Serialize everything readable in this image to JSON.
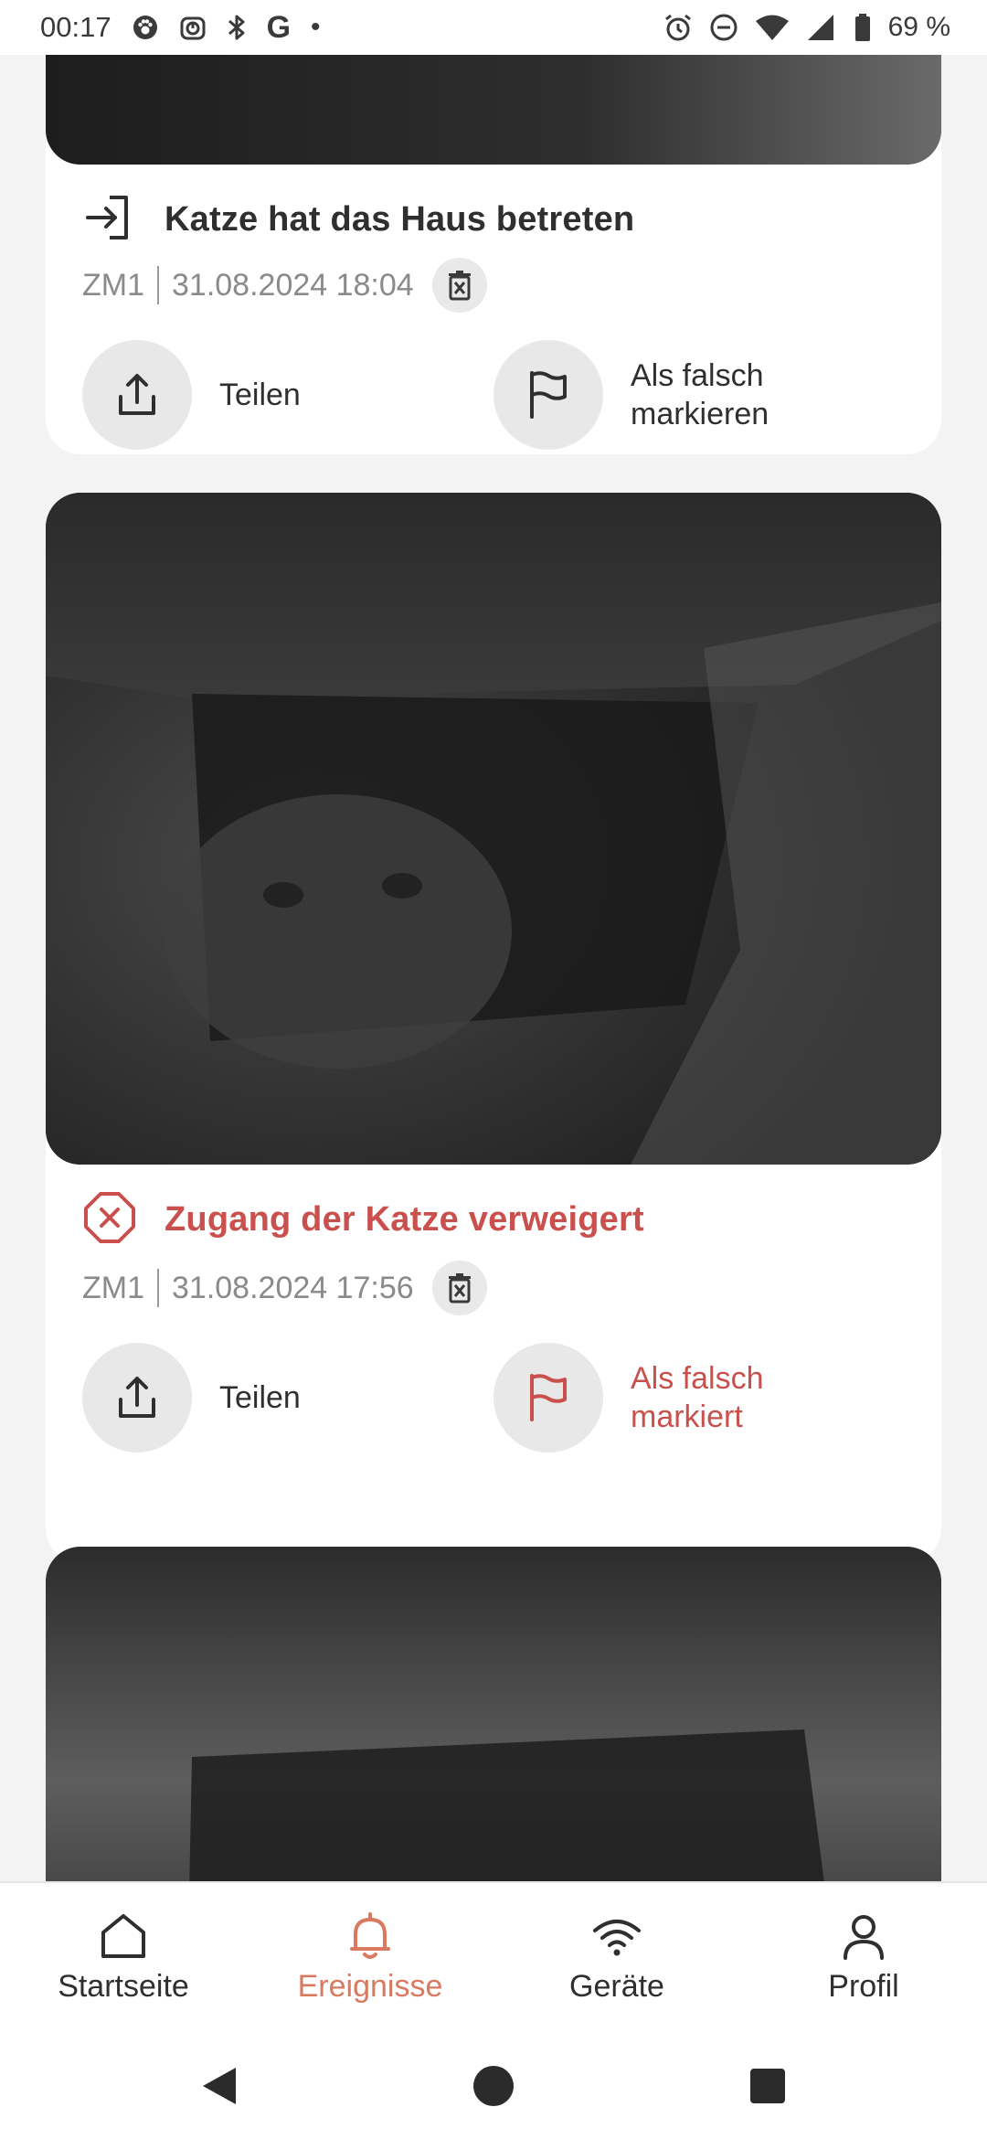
{
  "status_bar": {
    "time": "00:17",
    "google": "G",
    "dot": "•",
    "battery": "69 %",
    "icons": [
      "paw-notification-icon",
      "timer-icon",
      "bluetooth-icon",
      "google-icon",
      "alarm-icon",
      "do-not-disturb-icon",
      "wifi-icon",
      "signal-icon",
      "battery-icon"
    ]
  },
  "events": [
    {
      "icon": "enter-house-icon",
      "title": "Katze hat das Haus betreten",
      "device": "ZM1",
      "datetime": "31.08.2024 18:04",
      "share_label": "Teilen",
      "flag_label": "Als falsch markieren",
      "flagged": false
    },
    {
      "icon": "denied-icon",
      "title": "Zugang der Katze verweigert",
      "device": "ZM1",
      "datetime": "31.08.2024 17:56",
      "share_label": "Teilen",
      "flag_label": "Als falsch markiert",
      "flagged": true
    }
  ],
  "nav": {
    "items": [
      {
        "label": "Startseite",
        "icon": "home-icon"
      },
      {
        "label": "Ereignisse",
        "icon": "bell-icon",
        "active": true
      },
      {
        "label": "Geräte",
        "icon": "wifi-icon"
      },
      {
        "label": "Profil",
        "icon": "person-icon"
      }
    ]
  },
  "colors": {
    "accent": "#d9795f",
    "denied": "#c9504c",
    "text": "#2f2f2f",
    "meta": "#8a8a8a",
    "card": "#ffffff",
    "background": "#f3f3f3"
  }
}
